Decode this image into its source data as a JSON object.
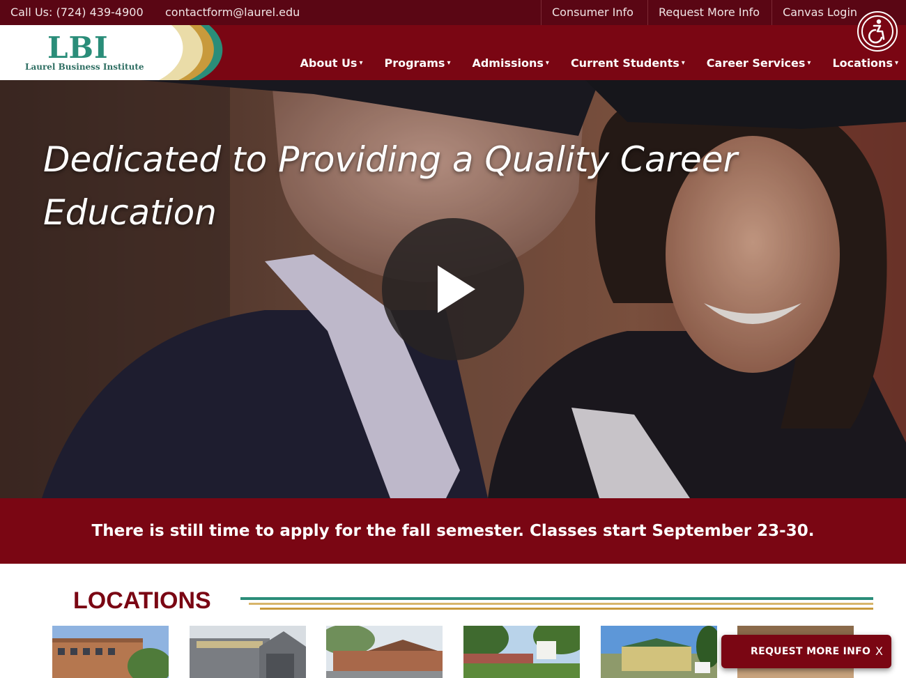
{
  "topbar": {
    "phone": "Call Us: (724) 439-4900",
    "email": "contactform@laurel.edu",
    "links": [
      "Consumer Info",
      "Request More Info",
      "Canvas Login"
    ]
  },
  "logo": {
    "mark": "LBI",
    "name": "Laurel Business Institute"
  },
  "nav": {
    "items": [
      "About Us",
      "Programs",
      "Admissions",
      "Current Students",
      "Career Services",
      "Locations"
    ],
    "caret": "▾"
  },
  "accessibility": {
    "icon": "accessibility-icon"
  },
  "hero": {
    "headline": "Dedicated to Providing a Quality Career Education",
    "play_icon": "play-icon"
  },
  "banner": {
    "text": "There is still time to apply for the fall semester. Classes start September 23-30."
  },
  "locations": {
    "title": "LOCATIONS"
  },
  "request_button": {
    "label": "REQUEST MORE INFO",
    "close": "X"
  },
  "colors": {
    "maroon": "#7a0613",
    "dark_maroon": "#5a0614",
    "teal": "#2a8d79",
    "gold": "#d8b56a"
  }
}
